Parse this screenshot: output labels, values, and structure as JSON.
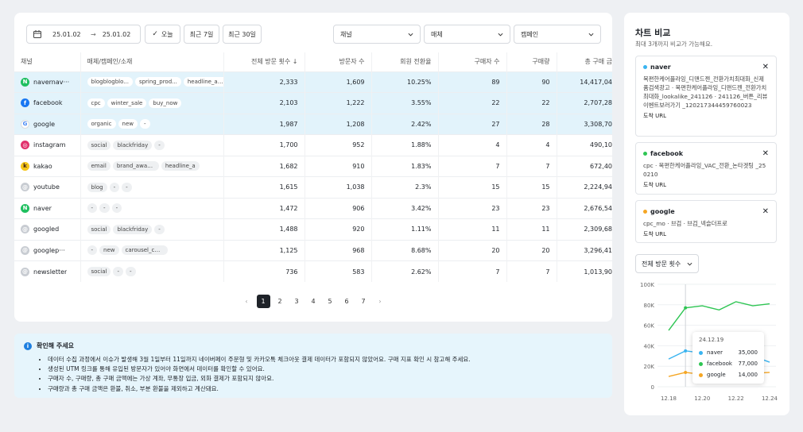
{
  "toolbar": {
    "date_from": "25.01.02",
    "arrow": "→",
    "date_to": "25.01.02",
    "today": "오늘",
    "last7": "최근 7일",
    "last30": "최근 30일",
    "channel_select": "채널",
    "medium_select": "매체",
    "campaign_select": "캠페인"
  },
  "table": {
    "columns": [
      "채널",
      "매체/캠페인/소재",
      "전체 방문 횟수 ↓",
      "방문자 수",
      "회원 전환율",
      "구매자 수",
      "구매량",
      "총 구매 금"
    ],
    "rows": [
      {
        "channel": "navernav···",
        "icon": "naver",
        "tags": [
          "blogblogblo...",
          "spring_prod...",
          "headline_ab..."
        ],
        "visits": "2,333",
        "visitors": "1,609",
        "rate": "10.25%",
        "buyers": "89",
        "qty": "90",
        "amount": "14,417,04",
        "hl": true
      },
      {
        "channel": "facebook",
        "icon": "facebook",
        "tags": [
          "cpc",
          "winter_sale",
          "buy_now"
        ],
        "visits": "2,103",
        "visitors": "1,222",
        "rate": "3.55%",
        "buyers": "22",
        "qty": "22",
        "amount": "2,707,28",
        "hl": true
      },
      {
        "channel": "google",
        "icon": "google",
        "tags": [
          "organic",
          "new",
          "-"
        ],
        "visits": "1,987",
        "visitors": "1,208",
        "rate": "2.42%",
        "buyers": "27",
        "qty": "28",
        "amount": "3,308,70",
        "hl": true
      },
      {
        "channel": "instagram",
        "icon": "instagram",
        "tags": [
          "social",
          "blackfriday",
          "-"
        ],
        "visits": "1,700",
        "visitors": "952",
        "rate": "1.88%",
        "buyers": "4",
        "qty": "4",
        "amount": "490,10",
        "hl": false
      },
      {
        "channel": "kakao",
        "icon": "kakao",
        "tags": [
          "email",
          "brand_awareness",
          "headline_a"
        ],
        "visits": "1,682",
        "visitors": "910",
        "rate": "1.83%",
        "buyers": "7",
        "qty": "7",
        "amount": "672,40",
        "hl": false
      },
      {
        "channel": "youtube",
        "icon": "generic",
        "tags": [
          "blog",
          "-",
          "-"
        ],
        "visits": "1,615",
        "visitors": "1,038",
        "rate": "2.3%",
        "buyers": "15",
        "qty": "15",
        "amount": "2,224,94",
        "hl": false
      },
      {
        "channel": "naver",
        "icon": "naver",
        "tags": [
          "-",
          "-",
          "-"
        ],
        "visits": "1,472",
        "visitors": "906",
        "rate": "3.42%",
        "buyers": "23",
        "qty": "23",
        "amount": "2,676,54",
        "hl": false
      },
      {
        "channel": "googled",
        "icon": "generic",
        "tags": [
          "social",
          "blackfriday",
          "-"
        ],
        "visits": "1,488",
        "visitors": "920",
        "rate": "1.11%",
        "buyers": "11",
        "qty": "11",
        "amount": "2,309,68",
        "hl": false
      },
      {
        "channel": "googlep···",
        "icon": "generic",
        "tags": [
          "-",
          "new",
          "carousel_content"
        ],
        "visits": "1,125",
        "visitors": "968",
        "rate": "8.68%",
        "buyers": "20",
        "qty": "20",
        "amount": "3,296,41",
        "hl": false
      },
      {
        "channel": "newsletter",
        "icon": "generic",
        "tags": [
          "social",
          "-",
          "-"
        ],
        "visits": "736",
        "visitors": "583",
        "rate": "2.62%",
        "buyers": "7",
        "qty": "7",
        "amount": "1,013,90",
        "hl": false
      }
    ]
  },
  "pagination": {
    "prev": "‹",
    "next": "›",
    "pages": [
      "1",
      "2",
      "3",
      "4",
      "5",
      "6",
      "7"
    ],
    "active": "1"
  },
  "notice": {
    "title": "확인해 주세요",
    "items": [
      "데이터 수집 과정에서 이슈가 발생해 3월 1일부터 11일까지 네이버페이 주문형 및 카카오톡 체크아웃 결제 데이터가 포함되지 않았어요. 구매 지표 확인 시 참고해 주세요.",
      "생성된 UTM 링크를 통해 유입된 방문자가 있어야 화면에서 데이터를 확인할 수 있어요.",
      "구매자 수, 구매량, 총 구매 금액에는 가상 계좌, 무통장 입금, 외화 결제가 포함되지 않아요.",
      "구매량과 총 구매 금액은 환불, 취소, 부분 환불을 제외하고 계산돼요."
    ]
  },
  "side": {
    "title": "차트 비교",
    "subtitle": "최대 3개까지 비교가 가능해요.",
    "cards": [
      {
        "name": "naver",
        "color": "#3ab4f0",
        "desc": "목편한케어플라잉_디맨드젠_전환가치최대화_신제품검색광고 · 목편한케어플라잉_디맨드젠_전환가치최대화_lookalike_241126 · 241126_버튼_리뷰이벤트보러가기 _120217344459760023",
        "url": "도착 URL"
      },
      {
        "name": "facebook",
        "color": "#2ec553",
        "desc": "cpc · 목편한케어플라잉_VAC_전환_논타겟팅 _250210",
        "url": "도착 URL"
      },
      {
        "name": "google",
        "color": "#f5a623",
        "desc": "cpc_mo · 브검 · 브검_넥슬더프로",
        "url": "도착 URL"
      }
    ],
    "metric": "전체 방문 횟수"
  },
  "chart_data": {
    "type": "line",
    "x": [
      "12.18",
      "12.19",
      "12.20",
      "12.21",
      "12.22",
      "12.23",
      "12.24"
    ],
    "x_ticks": [
      "12.18",
      "12.20",
      "12.22",
      "12.24"
    ],
    "y_ticks": [
      "100K",
      "80K",
      "60K",
      "40K",
      "20K",
      "0"
    ],
    "ylim": [
      0,
      100000
    ],
    "series": [
      {
        "name": "naver",
        "color": "#3ab4f0",
        "values": [
          27000,
          35000,
          33000,
          31000,
          34000,
          30000,
          24000
        ]
      },
      {
        "name": "facebook",
        "color": "#2ec553",
        "values": [
          55000,
          77000,
          79000,
          75000,
          83000,
          79000,
          81000
        ]
      },
      {
        "name": "google",
        "color": "#f5a623",
        "values": [
          10000,
          14000,
          12000,
          11000,
          12500,
          13000,
          14000
        ]
      }
    ],
    "tooltip": {
      "date": "24.12.19",
      "rows": [
        {
          "name": "naver",
          "value": "35,000",
          "color": "#3ab4f0"
        },
        {
          "name": "facebook",
          "value": "77,000",
          "color": "#2ec553"
        },
        {
          "name": "google",
          "value": "14,000",
          "color": "#f5a623"
        }
      ]
    }
  }
}
